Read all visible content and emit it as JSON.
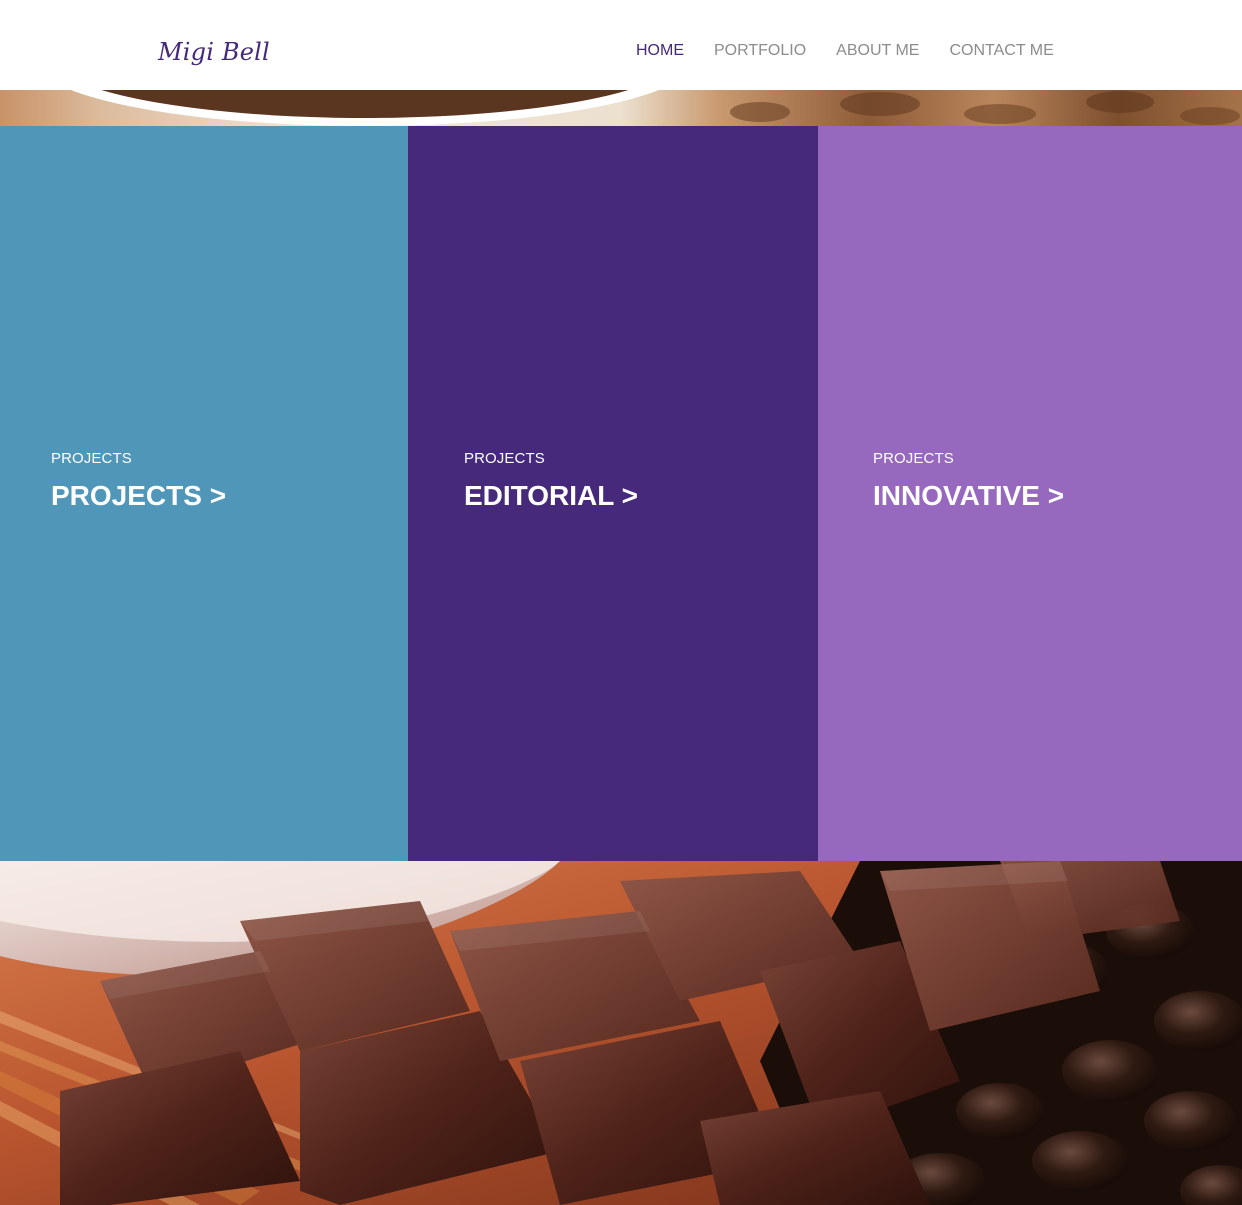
{
  "site": {
    "logo": "Migi Bell"
  },
  "nav": {
    "items": [
      {
        "label": "HOME",
        "active": true
      },
      {
        "label": "PORTFOLIO",
        "active": false
      },
      {
        "label": "ABOUT ME",
        "active": false
      },
      {
        "label": "CONTACT ME",
        "active": false
      }
    ]
  },
  "tiles": [
    {
      "kicker": "PROJECTS",
      "title": "PROJECTS >",
      "color": "#5096b9"
    },
    {
      "kicker": "PROJECTS",
      "title": "EDITORIAL >",
      "color": "#46297a"
    },
    {
      "kicker": "PROJECTS",
      "title": "INNOVATIVE >",
      "color": "#9769be"
    }
  ],
  "colors": {
    "brand": "#44297a",
    "nav_inactive": "#8c8c8c"
  }
}
